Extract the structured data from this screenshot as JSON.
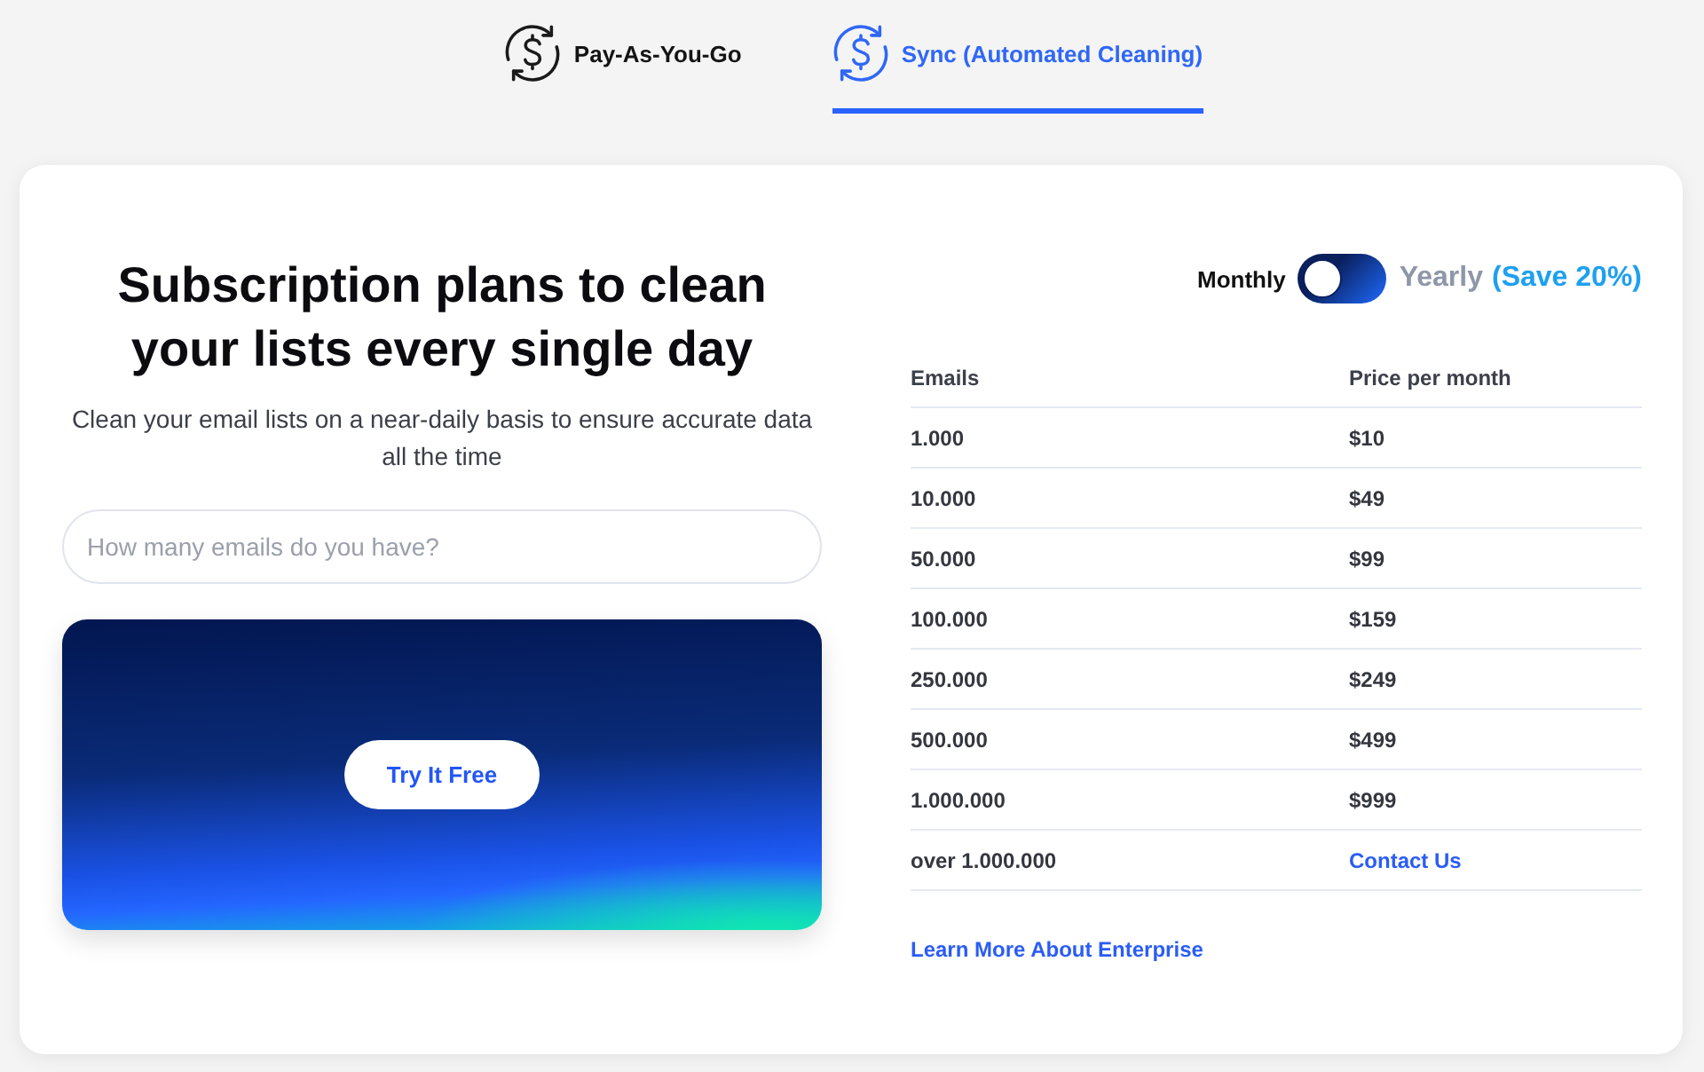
{
  "tabs": [
    {
      "label": "Pay-As-You-Go",
      "selected": false
    },
    {
      "label": "Sync (Automated Cleaning)",
      "selected": true
    }
  ],
  "intro": {
    "title": "Subscription plans to clean your lists every single day",
    "subtitle": "Clean your email lists on a near-daily basis to ensure accurate data all the time"
  },
  "email_count_field": {
    "placeholder": "How many emails do you have?"
  },
  "cta": {
    "button": "Try It Free"
  },
  "billing": {
    "monthly_label": "Monthly",
    "yearly_label": "Yearly",
    "yearly_note": "(Save 20%)",
    "yearly": false
  },
  "pricing_table": {
    "columns": [
      "Emails",
      "Price per month"
    ],
    "rows": [
      {
        "emails": "1.000",
        "price": "$10",
        "kind": "price"
      },
      {
        "emails": "10.000",
        "price": "$49",
        "kind": "price"
      },
      {
        "emails": "50.000",
        "price": "$99",
        "kind": "price"
      },
      {
        "emails": "100.000",
        "price": "$159",
        "kind": "price"
      },
      {
        "emails": "250.000",
        "price": "$249",
        "kind": "price"
      },
      {
        "emails": "500.000",
        "price": "$499",
        "kind": "price"
      },
      {
        "emails": "1.000.000",
        "price": "$999",
        "kind": "price"
      },
      {
        "emails": "over 1.000.000",
        "price": "Contact Us",
        "kind": "link"
      }
    ]
  },
  "enterprise_link": "Learn More About Enterprise"
}
